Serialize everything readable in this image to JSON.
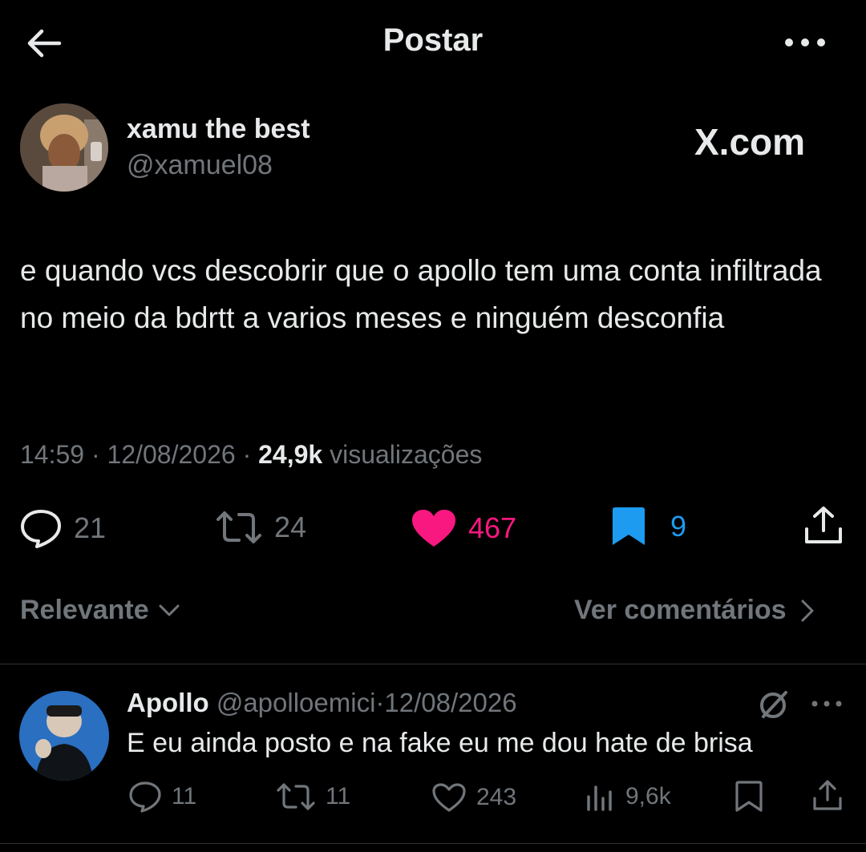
{
  "header": {
    "title": "Postar",
    "back_icon": "arrow-left-icon",
    "more_icon": "more-horizontal-icon"
  },
  "post": {
    "display_name": "xamu the best",
    "handle": "@xamuel08",
    "brand": "X.com",
    "text": "e quando vcs descobrir que o apollo tem uma conta infiltrada no meio da bdrtt a varios meses e ninguém desconfia",
    "time": "14:59",
    "sep": "·",
    "date": "12/08/2026",
    "views_count": "24,9k",
    "views_label": "visualizações",
    "actions": {
      "replies": "21",
      "reposts": "24",
      "likes": "467",
      "bookmarks": "9"
    },
    "colors": {
      "like": "#f91880",
      "bookmark": "#1d9bf0",
      "muted": "#71767b"
    }
  },
  "sort": {
    "label": "Relevante",
    "view_comments": "Ver comentários"
  },
  "reply": {
    "display_name": "Apollo",
    "handle": "@apolloemici",
    "sep": "·",
    "date": "12/08/2026",
    "text": "E eu ainda posto e na fake eu me dou hate de brisa",
    "actions": {
      "replies": "11",
      "reposts": "11",
      "likes": "243",
      "views": "9,6k"
    }
  }
}
